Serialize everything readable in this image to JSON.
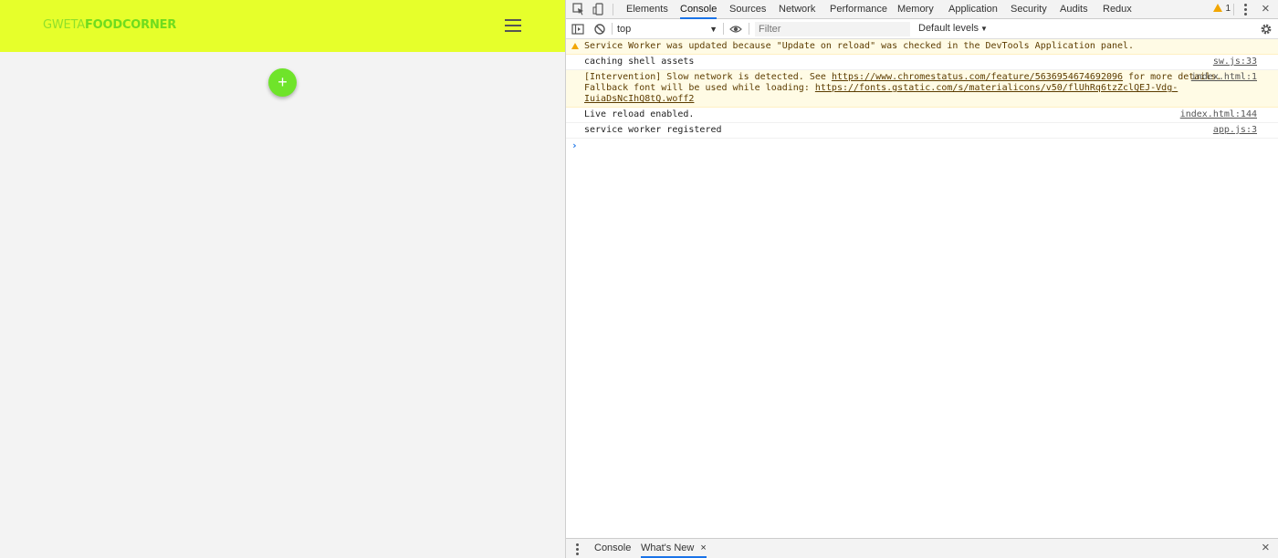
{
  "app": {
    "brand_part1": "GWETA",
    "brand_part2": "FOODCORNER",
    "fab_label": "+",
    "header_color": "#e6ff2b",
    "fab_color": "#6fe42a"
  },
  "devtools": {
    "tabs": [
      "Elements",
      "Console",
      "Sources",
      "Network",
      "Performance",
      "Memory",
      "Application",
      "Security",
      "Audits",
      "Redux"
    ],
    "active_tab": "Console",
    "warning_count": "1",
    "context": "top",
    "filter_placeholder": "Filter",
    "levels_label": "Default levels",
    "messages": [
      {
        "type": "warning",
        "text": "Service Worker was updated because \"Update on reload\" was checked in the DevTools Application panel.",
        "source": ""
      },
      {
        "type": "log",
        "text": "caching shell assets",
        "source": "sw.js:33"
      },
      {
        "type": "warning",
        "text_pre": "[Intervention] Slow network is detected. See ",
        "link1": "https://www.chromestatus.com/feature/5636954674692096",
        "text_mid": " for more details.",
        "line2_pre": "Fallback font will be used while loading: ",
        "link2": "https://fonts.gstatic.com/s/materialicons/v50/flUhRq6tzZclQEJ-Vdg-IuiaDsNcIhQ8tQ.woff2",
        "source": "index.html:1"
      },
      {
        "type": "log",
        "text": "Live reload enabled.",
        "source": "index.html:144"
      },
      {
        "type": "log",
        "text": "service worker registered",
        "source": "app.js:3"
      }
    ],
    "prompt": "›",
    "drawer_tabs": [
      "Console",
      "What's New"
    ],
    "drawer_close": "×",
    "close": "×"
  }
}
